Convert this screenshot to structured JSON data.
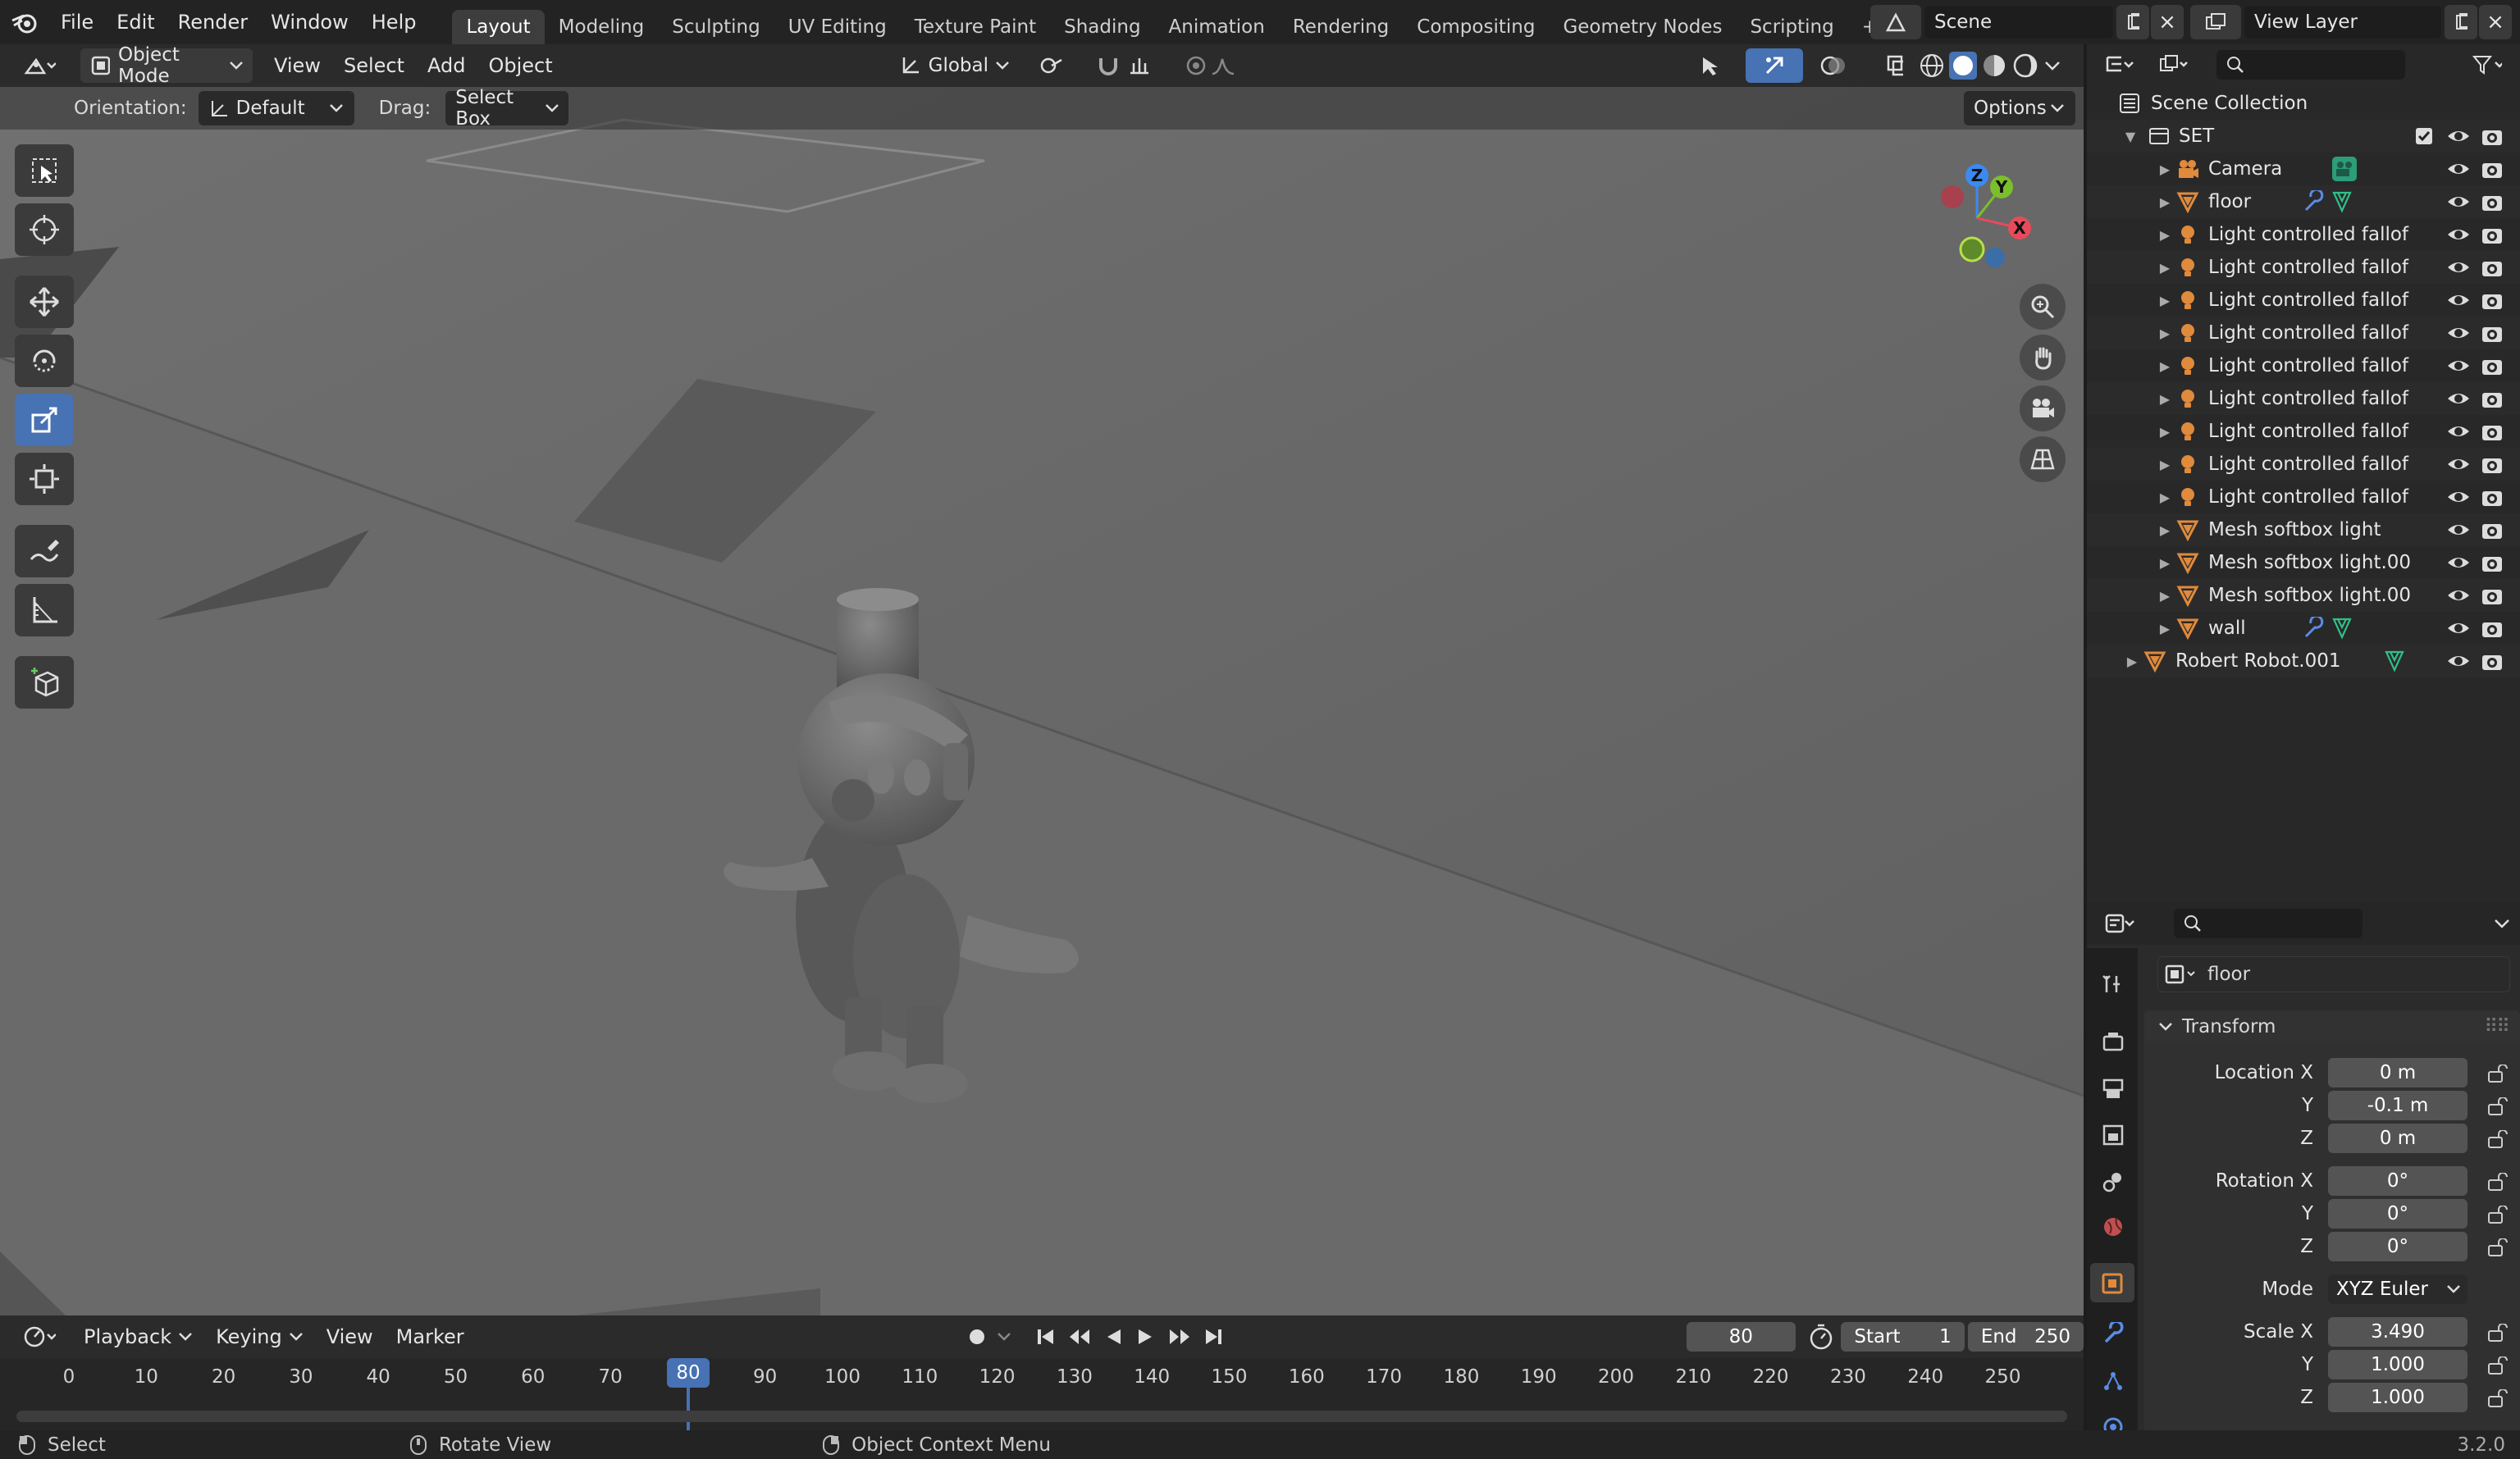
{
  "topbar": {
    "menu": [
      "File",
      "Edit",
      "Render",
      "Window",
      "Help"
    ],
    "workspaces": [
      "Layout",
      "Modeling",
      "Sculpting",
      "UV Editing",
      "Texture Paint",
      "Shading",
      "Animation",
      "Rendering",
      "Compositing",
      "Geometry Nodes",
      "Scripting"
    ],
    "add_tab": "+",
    "scene": "Scene",
    "view_layer": "View Layer"
  },
  "viewport_header": {
    "mode": "Object Mode",
    "menus": [
      "View",
      "Select",
      "Add",
      "Object"
    ],
    "transform_orientation": "Global"
  },
  "tool_settings": {
    "orientation_label": "Orientation:",
    "orientation_value": "Default",
    "drag_label": "Drag:",
    "drag_value": "Select Box",
    "options": "Options"
  },
  "gizmo": {
    "z": "Z",
    "y": "Y",
    "x": "X"
  },
  "outliner": {
    "root": "Scene Collection",
    "collection": "SET",
    "items": [
      {
        "name": "Camera",
        "type": "camera"
      },
      {
        "name": "floor",
        "type": "mesh"
      },
      {
        "name": "Light controlled fallof",
        "type": "light"
      },
      {
        "name": "Light controlled fallof",
        "type": "light"
      },
      {
        "name": "Light controlled fallof",
        "type": "light"
      },
      {
        "name": "Light controlled fallof",
        "type": "light"
      },
      {
        "name": "Light controlled fallof",
        "type": "light"
      },
      {
        "name": "Light controlled fallof",
        "type": "light"
      },
      {
        "name": "Light controlled fallof",
        "type": "light"
      },
      {
        "name": "Light controlled fallof",
        "type": "light"
      },
      {
        "name": "Light controlled fallof",
        "type": "light"
      },
      {
        "name": "Mesh softbox light",
        "type": "mesh"
      },
      {
        "name": "Mesh softbox light.00",
        "type": "mesh"
      },
      {
        "name": "Mesh softbox light.00",
        "type": "mesh"
      },
      {
        "name": "wall",
        "type": "mesh"
      }
    ],
    "top_object": "Robert Robot.001"
  },
  "properties": {
    "object_name": "floor",
    "panel": "Transform",
    "location": {
      "label_x": "Location X",
      "y_label": "Y",
      "z_label": "Z",
      "x": "0 m",
      "y": "-0.1 m",
      "z": "0 m"
    },
    "rotation": {
      "label_x": "Rotation X",
      "y_label": "Y",
      "z_label": "Z",
      "x": "0°",
      "y": "0°",
      "z": "0°"
    },
    "mode_label": "Mode",
    "mode": "XYZ Euler",
    "scale": {
      "label_x": "Scale X",
      "y_label": "Y",
      "z_label": "Z",
      "x": "3.490",
      "y": "1.000",
      "z": "1.000"
    }
  },
  "timeline": {
    "menus": [
      "Playback",
      "Keying",
      "View",
      "Marker"
    ],
    "current_frame": "80",
    "start_label": "Start",
    "start": "1",
    "end_label": "End",
    "end": "250",
    "ticks": [
      "0",
      "10",
      "20",
      "30",
      "40",
      "50",
      "60",
      "70",
      "80",
      "90",
      "100",
      "110",
      "120",
      "130",
      "140",
      "150",
      "160",
      "170",
      "180",
      "190",
      "200",
      "210",
      "220",
      "230",
      "240",
      "250"
    ]
  },
  "statusbar": {
    "select": "Select",
    "rotate": "Rotate View",
    "context": "Object Context Menu",
    "version": "3.2.0"
  },
  "colors": {
    "accent": "#4772b3",
    "header": "#2b2b2b",
    "viewport": "#6b6b6b",
    "mesh": "#e08a3c",
    "light": "#e08a3c",
    "camera": "#2d9c79"
  }
}
